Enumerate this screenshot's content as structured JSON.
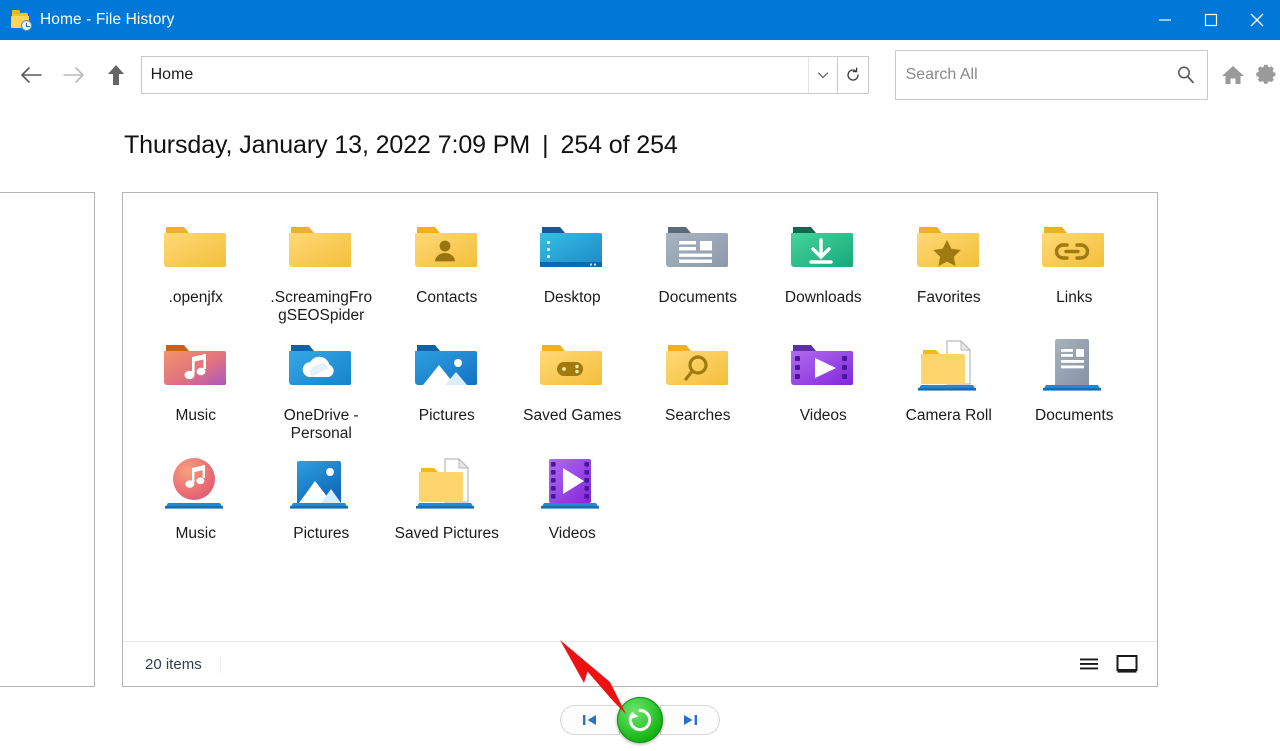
{
  "window": {
    "title": "Home - File History",
    "app_icon": "folder-history-icon",
    "minimize_label": "Minimize",
    "maximize_label": "Maximize",
    "close_label": "Close",
    "titlebar_color": "#0078d7"
  },
  "nav": {
    "back_label": "Back",
    "forward_label": "Forward",
    "up_label": "Up",
    "address_value": "Home",
    "address_dropdown": "chevron-down-icon",
    "refresh_label": "Refresh",
    "home_label": "Home",
    "settings_label": "Settings"
  },
  "search": {
    "placeholder": "Search All",
    "value": "",
    "icon": "search-icon"
  },
  "header": {
    "date": "Thursday, January 13, 2022 7:09 PM",
    "separator": "|",
    "version": "254 of 254"
  },
  "files": [
    {
      "name": ".openjfx",
      "icon": "folder-plain-icon",
      "kind": "folder"
    },
    {
      "name": ".ScreamingFrogSEOSpider",
      "icon": "folder-plain-icon",
      "kind": "folder"
    },
    {
      "name": "Contacts",
      "icon": "folder-contacts-icon",
      "kind": "folder"
    },
    {
      "name": "Desktop",
      "icon": "folder-desktop-icon",
      "kind": "folder"
    },
    {
      "name": "Documents",
      "icon": "folder-documents-icon",
      "kind": "folder"
    },
    {
      "name": "Downloads",
      "icon": "folder-downloads-icon",
      "kind": "folder"
    },
    {
      "name": "Favorites",
      "icon": "folder-favorites-icon",
      "kind": "folder"
    },
    {
      "name": "Links",
      "icon": "folder-links-icon",
      "kind": "folder"
    },
    {
      "name": "Music",
      "icon": "folder-music-icon",
      "kind": "folder"
    },
    {
      "name": "OneDrive - Personal",
      "icon": "folder-onedrive-icon",
      "kind": "folder"
    },
    {
      "name": "Pictures",
      "icon": "folder-pictures-icon",
      "kind": "folder"
    },
    {
      "name": "Saved Games",
      "icon": "folder-saved-games-icon",
      "kind": "folder"
    },
    {
      "name": "Searches",
      "icon": "folder-searches-icon",
      "kind": "folder"
    },
    {
      "name": "Videos",
      "icon": "folder-videos-icon",
      "kind": "folder"
    },
    {
      "name": "Camera Roll",
      "icon": "library-camera-roll-icon",
      "kind": "library"
    },
    {
      "name": "Documents",
      "icon": "library-documents-icon",
      "kind": "library"
    },
    {
      "name": "Music",
      "icon": "library-music-icon",
      "kind": "library"
    },
    {
      "name": "Pictures",
      "icon": "library-pictures-icon",
      "kind": "library"
    },
    {
      "name": "Saved Pictures",
      "icon": "library-saved-pictures-icon",
      "kind": "library"
    },
    {
      "name": "Videos",
      "icon": "library-videos-icon",
      "kind": "library"
    }
  ],
  "status": {
    "item_count": "20 items",
    "view_details_label": "Details view",
    "view_large_icons_label": "Large icons view"
  },
  "transport": {
    "previous_label": "Previous version",
    "restore_label": "Restore to original location",
    "next_label": "Next version",
    "restore_color": "#1fb81f"
  },
  "annotation": {
    "arrow_color": "#ee1111",
    "arrow_name": "red-callout-arrow"
  }
}
